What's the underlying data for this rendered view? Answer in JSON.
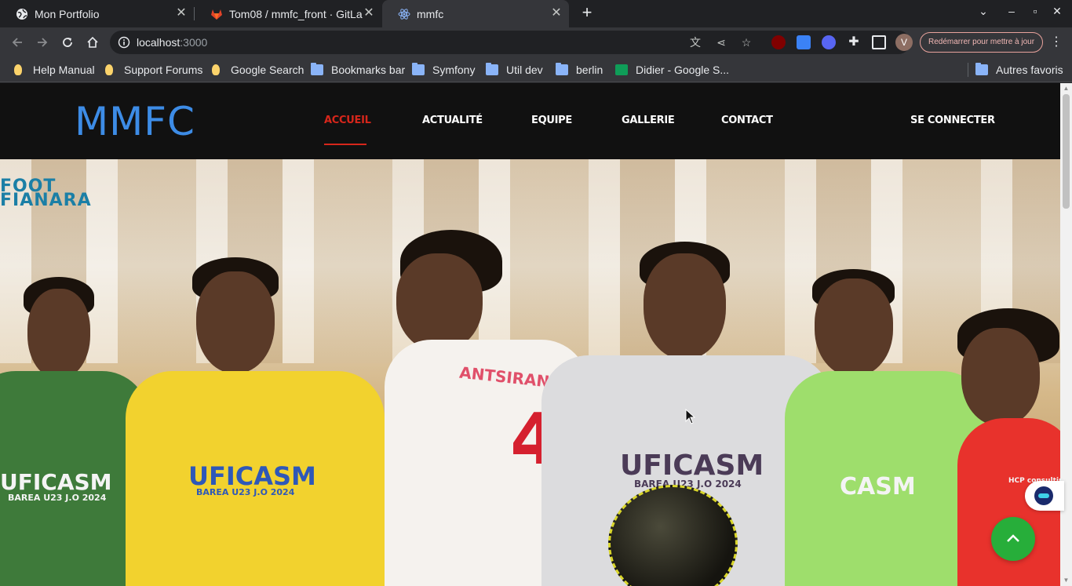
{
  "browser": {
    "tabs": [
      {
        "title": "Mon Portfolio",
        "icon": "globe-icon"
      },
      {
        "title": "Tom08 / mmfc_front · GitLab",
        "icon": "gitlab-icon"
      },
      {
        "title": "mmfc",
        "icon": "react-icon",
        "active": true
      }
    ],
    "address": {
      "host": "localhost",
      "port": ":3000"
    },
    "restart_label": "Redémarrer pour mettre à jour",
    "avatar_letter": "V",
    "bookmarks": [
      {
        "label": "Help Manual",
        "icon": "bulb-icon"
      },
      {
        "label": "Support Forums",
        "icon": "bulb-icon"
      },
      {
        "label": "Google Search",
        "icon": "bulb-icon"
      },
      {
        "label": "Bookmarks bar",
        "icon": "folder-icon"
      },
      {
        "label": "Symfony",
        "icon": "folder-icon"
      },
      {
        "label": "Util dev",
        "icon": "folder-icon"
      },
      {
        "label": "berlin",
        "icon": "folder-icon"
      },
      {
        "label": "Didier - Google S...",
        "icon": "sheets-icon"
      }
    ],
    "other_bookmarks": "Autres favoris"
  },
  "site": {
    "logo": "MMFC",
    "menu": [
      {
        "label": "ACCUEIL",
        "active": true
      },
      {
        "label": "ACTUALITÉ"
      },
      {
        "label": "EQUIPE"
      },
      {
        "label": "GALLERIE"
      },
      {
        "label": "CONTACT"
      }
    ],
    "login_label": "SE CONNECTER",
    "accent_color": "#d7261b",
    "logo_color": "#3d8ce6"
  },
  "hero": {
    "brand_line1": "FOOT",
    "brand_line2": "FIANARA",
    "jersey_texts": [
      "UFICASM",
      "BAREA U23 J.O 2024",
      "UFICASM",
      "BAREA U23 J.O 2024",
      "ANTSIRANANA",
      "4",
      "UFICASM",
      "BAREA U23 J.O 2024",
      "CASM",
      "HCP consulting"
    ]
  },
  "widgets": {
    "chat_icon": "chatbot-icon",
    "back_to_top_icon": "chevron-up-icon",
    "back_to_top_color": "#27ae3a"
  }
}
